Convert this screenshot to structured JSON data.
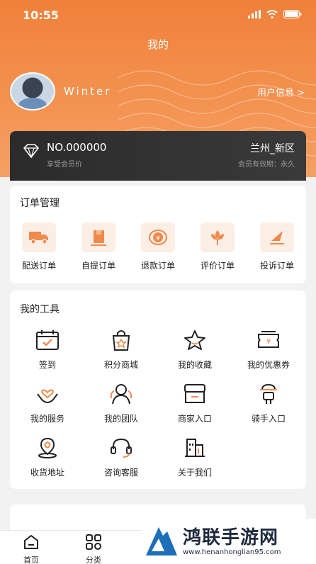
{
  "status": {
    "time": "10:55"
  },
  "header": {
    "title": "我的"
  },
  "user": {
    "name": "Winter",
    "info_link": "用户信息 >"
  },
  "member": {
    "number": "NO.000000",
    "subtitle": "享受会员价",
    "location": "兰州_新区",
    "validity": "会员有效期：永久"
  },
  "orders": {
    "title": "订单管理",
    "items": [
      {
        "label": "配送订单",
        "icon": "truck-icon"
      },
      {
        "label": "自提订单",
        "icon": "box-icon"
      },
      {
        "label": "退款订单",
        "icon": "refund-coin-icon"
      },
      {
        "label": "评价订单",
        "icon": "flower-icon"
      },
      {
        "label": "投诉订单",
        "icon": "paper-plane-icon"
      }
    ]
  },
  "tools": {
    "title": "我的工具",
    "items": [
      {
        "label": "签到",
        "icon": "calendar-check-icon"
      },
      {
        "label": "积分商城",
        "icon": "shopping-bag-icon"
      },
      {
        "label": "我的收藏",
        "icon": "star-icon"
      },
      {
        "label": "我的优惠券",
        "icon": "coupon-icon"
      },
      {
        "label": "我的服务",
        "icon": "heart-hand-icon"
      },
      {
        "label": "我的团队",
        "icon": "team-icon"
      },
      {
        "label": "商家入口",
        "icon": "store-icon"
      },
      {
        "label": "骑手入口",
        "icon": "rider-icon"
      },
      {
        "label": "收货地址",
        "icon": "location-pin-icon"
      },
      {
        "label": "咨询客服",
        "icon": "headset-icon"
      },
      {
        "label": "关于我们",
        "icon": "building-icon"
      }
    ]
  },
  "tabbar": {
    "items": [
      {
        "label": "首页"
      },
      {
        "label": "分类"
      }
    ]
  },
  "watermark": {
    "text": "鸿联手游网",
    "url": "www.henanhonglian95.com"
  },
  "colors": {
    "accent": "#f0803a",
    "card_dark": "#2b2b2b",
    "icon_bg": "#fbeee5"
  }
}
